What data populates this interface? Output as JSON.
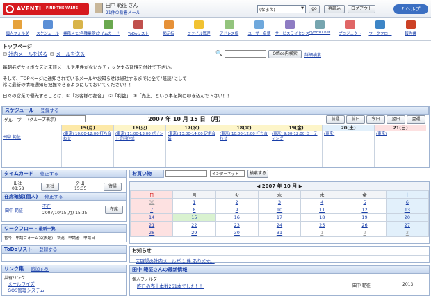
{
  "header": {
    "brand": "AVENTI",
    "tagline": "FIND THE VALUE",
    "user": "田中 範征 さん",
    "user_msg": "21件の新着メール",
    "select": "(なまえ)",
    "buttons": [
      "go",
      "再読込",
      "ログアウト"
    ],
    "help": "ヘルプ"
  },
  "apps": [
    {
      "label": "個人フォルダ",
      "color": "#e6a23c"
    },
    {
      "label": "スケジュール",
      "color": "#5b8fd6"
    },
    {
      "label": "業務メモ(各種業務)",
      "color": "#d8b44a"
    },
    {
      "label": "タイムカード",
      "color": "#6aa84f"
    },
    {
      "label": "ToDoリスト",
      "color": "#c0504d"
    },
    {
      "label": "掲示板",
      "color": "#e69138"
    },
    {
      "label": "ファイル管理",
      "color": "#f1c232"
    },
    {
      "label": "アドレス帳",
      "color": "#93c47d"
    },
    {
      "label": "ユーザー名簿",
      "color": "#6fa8dc"
    },
    {
      "label": "サービスライセンス",
      "color": "#8e7cc3"
    },
    {
      "label": "cybozu.net",
      "color": "#76a5af"
    },
    {
      "label": "プロジェクト",
      "color": "#e06666"
    },
    {
      "label": "ワークフロー",
      "color": "#3d85c6"
    },
    {
      "label": "報告書",
      "color": "#cc4125"
    }
  ],
  "crumb": "トップページ",
  "mail": {
    "send_internal": "社内メールを送る",
    "send_external": "メールを送る",
    "search_btn": "Office内検索",
    "detail": "詳細検索"
  },
  "notice": [
    "毎朝必ずサイボウズに未読メールや用件がないかチェックする習慣を付けて下さい。",
    "そして、TOPページに通知されているメールやお知らせは帰社するまでに全て\"既読\"にして",
    "常に最新の情報通知を把握できるようにしておいてください！！",
    "日々の営業で優先することは、①「お客様の都合」　②「利益」　③「売上」という事を胸に叩き込んで下さい！！"
  ],
  "schedule": {
    "title": "スケジュール",
    "register": "登録する",
    "date": "2007 年 10 月 15 日 （月）",
    "group_label": "グループ",
    "group_value": "(グループ表示)",
    "nav": [
      "前週",
      "前日",
      "今日",
      "翌日",
      "翌週"
    ],
    "user": "田中 範征",
    "days": [
      {
        "h": "15(月)",
        "bg": "#fde9a8",
        "ev": "(東京) 10:00-12:00 打ち合わせ"
      },
      {
        "h": "16(火)",
        "bg": "#fdf5c9",
        "ev": "(東京) 11:00-13:00 ポイント資料作成"
      },
      {
        "h": "17(水)",
        "bg": "#fdf5c9",
        "ev": "(東京) 13:00-14:00 定例会議"
      },
      {
        "h": "18(木)",
        "bg": "#fdf5c9",
        "ev": "(東京) 10:00-12:00 打ち合わせ"
      },
      {
        "h": "19(金)",
        "bg": "#fdf5c9",
        "ev": "(東京) 9:30-12:00 ミーティング"
      },
      {
        "h": "20(土)",
        "bg": "#e2f0fb",
        "ev": "(東京)"
      },
      {
        "h": "21(日)",
        "bg": "#fde1e1",
        "ev": "(東京)"
      }
    ]
  },
  "timecard": {
    "title": "タイムカード",
    "fix": "修正する",
    "in_l": "出社",
    "in_v": "08:58",
    "out_l": "外出",
    "out_v": "15:35",
    "b1": "退社",
    "b2": "復帰"
  },
  "presence": {
    "title": "在席確認(個人)",
    "fix": "修正する",
    "name": "田中 範征",
    "status": "不在",
    "time": "2007/10/15(月) 15:35",
    "btn": "在席"
  },
  "workflow": {
    "title": "ワークフロー",
    "sub": "最新一覧",
    "cols": "番号　申請フォーム名(表題)　状況　申請者　申請日"
  },
  "todo": {
    "title": "ToDoリスト",
    "register": "登録する"
  },
  "links": {
    "title": "リンク集",
    "add": "追加する",
    "group": "共有リンク",
    "items": [
      "メールワイズ",
      "GOS管理システム"
    ]
  },
  "shopping": {
    "title": "お買い物",
    "engine": "インターネット",
    "btn": "検索する"
  },
  "calendar": {
    "month": "2007 年 10 月",
    "heads": [
      "日",
      "月",
      "火",
      "水",
      "木",
      "金",
      "土"
    ],
    "rows": [
      [
        "30",
        "1",
        "2",
        "3",
        "4",
        "5",
        "6"
      ],
      [
        "7",
        "8",
        "9",
        "10",
        "11",
        "12",
        "13"
      ],
      [
        "14",
        "15",
        "16",
        "17",
        "18",
        "19",
        "20"
      ],
      [
        "21",
        "22",
        "23",
        "24",
        "25",
        "26",
        "27"
      ],
      [
        "28",
        "29",
        "30",
        "31",
        "1",
        "2",
        "3"
      ]
    ]
  },
  "news": {
    "title": "お知らせ",
    "msg": "未確認の社内メールが 1 件 あります。"
  },
  "latest": {
    "title": "田中 範征さんの最新情報",
    "folder": "個人フォルダ",
    "item": "昨日の売上本数261本でした！！",
    "who": "田中 範征",
    "num": "2013"
  }
}
